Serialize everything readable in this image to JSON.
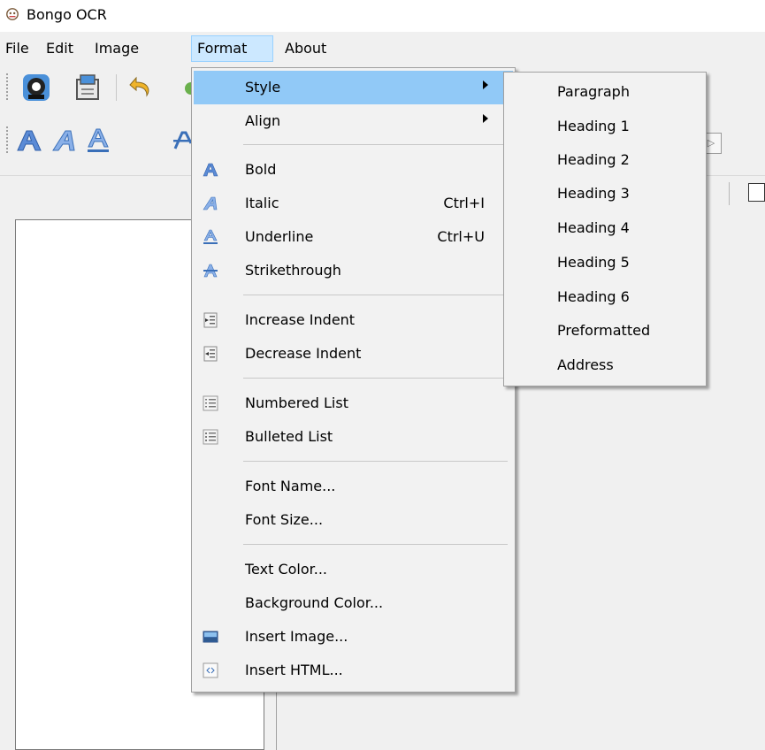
{
  "window": {
    "title": "Bongo OCR",
    "icon": "app-logo-icon"
  },
  "menubar": [
    "File",
    "Edit",
    "Image",
    "Format",
    "About"
  ],
  "toolbar1": {
    "icons": [
      "webcam-icon",
      "open-file-icon",
      "undo-icon",
      "redo-icon"
    ]
  },
  "toolbar2": {
    "icons": [
      "bold-format-icon",
      "italic-format-icon",
      "underline-format-icon",
      "strikethrough-format-icon",
      "next-icon"
    ]
  },
  "format_menu": {
    "items": [
      {
        "label": "Style",
        "shortcut": "",
        "submenu": true,
        "icon": "",
        "highlighted": true
      },
      {
        "label": "Align",
        "shortcut": "",
        "submenu": true,
        "icon": ""
      },
      {
        "label": "Bold",
        "shortcut": "",
        "icon": "bold-icon"
      },
      {
        "label": "Italic",
        "shortcut": "Ctrl+I",
        "icon": "italic-icon"
      },
      {
        "label": "Underline",
        "shortcut": "Ctrl+U",
        "icon": "underline-icon"
      },
      {
        "label": "Strikethrough",
        "shortcut": "",
        "icon": "strikethrough-icon"
      },
      {
        "label": "Increase Indent",
        "shortcut": "",
        "icon": "increase-indent-icon"
      },
      {
        "label": "Decrease Indent",
        "shortcut": "",
        "icon": "decrease-indent-icon"
      },
      {
        "label": "Numbered List",
        "shortcut": "",
        "icon": "numbered-list-icon"
      },
      {
        "label": "Bulleted List",
        "shortcut": "",
        "icon": "bulleted-list-icon"
      },
      {
        "label": "Font Name...",
        "shortcut": "",
        "icon": ""
      },
      {
        "label": "Font Size...",
        "shortcut": "",
        "icon": ""
      },
      {
        "label": "Text Color...",
        "shortcut": "",
        "icon": ""
      },
      {
        "label": "Background Color...",
        "shortcut": "",
        "icon": ""
      },
      {
        "label": "Insert Image...",
        "shortcut": "",
        "icon": "insert-image-icon"
      },
      {
        "label": "Insert HTML...",
        "shortcut": "",
        "icon": "insert-html-icon"
      }
    ]
  },
  "style_submenu": {
    "items": [
      "Paragraph",
      "Heading 1",
      "Heading 2",
      "Heading 3",
      "Heading 4",
      "Heading 5",
      "Heading 6",
      "Preformatted",
      "Address"
    ]
  },
  "colors": {
    "highlight": "#91c9f7",
    "menubar_active": "#cce8ff",
    "menu_bg": "#f2f2f2",
    "format_icon_blue": "#3a6fb8"
  }
}
